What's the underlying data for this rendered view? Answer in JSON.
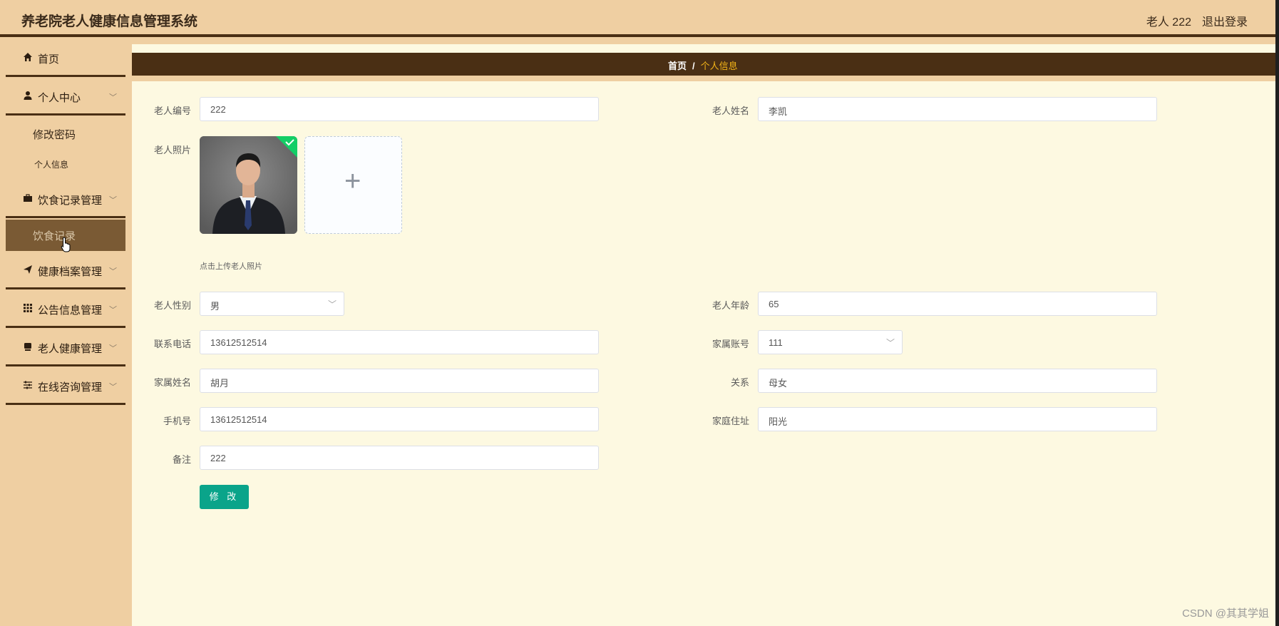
{
  "header": {
    "title": "养老院老人健康信息管理系统",
    "user": "老人 222",
    "logout": "退出登录"
  },
  "sidebar": {
    "items": [
      {
        "label": "首页",
        "icon": "home-icon"
      },
      {
        "label": "个人中心",
        "icon": "user-icon",
        "expanded": true,
        "children": [
          "修改密码",
          "个人信息"
        ]
      },
      {
        "label": "饮食记录管理",
        "icon": "briefcase-icon",
        "expanded": true,
        "children": [
          "饮食记录"
        ]
      },
      {
        "label": "健康档案管理",
        "icon": "send-icon"
      },
      {
        "label": "公告信息管理",
        "icon": "grid-icon"
      },
      {
        "label": "老人健康管理",
        "icon": "tablet-icon"
      },
      {
        "label": "在线咨询管理",
        "icon": "sliders-icon"
      }
    ],
    "active_item": "饮食记录"
  },
  "breadcrumb": {
    "home": "首页",
    "separator": "/",
    "current": "个人信息"
  },
  "form": {
    "elder_id": {
      "label": "老人编号",
      "value": "222"
    },
    "elder_name": {
      "label": "老人姓名",
      "value": "李凯"
    },
    "photo": {
      "label": "老人照片",
      "tip": "点击上传老人照片"
    },
    "gender": {
      "label": "老人性别",
      "value": "男"
    },
    "age": {
      "label": "老人年龄",
      "value": "65"
    },
    "phone": {
      "label": "联系电话",
      "value": "13612512514"
    },
    "family_account": {
      "label": "家属账号",
      "value": "111"
    },
    "family_name": {
      "label": "家属姓名",
      "value": "胡月"
    },
    "relation": {
      "label": "关系",
      "value": "母女"
    },
    "mobile": {
      "label": "手机号",
      "value": "13612512514"
    },
    "address": {
      "label": "家庭住址",
      "value": "阳光"
    },
    "remark": {
      "label": "备注",
      "value": "222"
    },
    "submit": "修 改"
  },
  "watermark": "CSDN @其其学姐",
  "colors": {
    "sidebar_bg": "#efcfa2",
    "accent_dark": "#4a2f14",
    "active_item_bg": "#7a5a34",
    "main_bg": "#fdf9e1",
    "breadcrumb_current": "#f3b418",
    "submit_button": "#0aa48a"
  }
}
